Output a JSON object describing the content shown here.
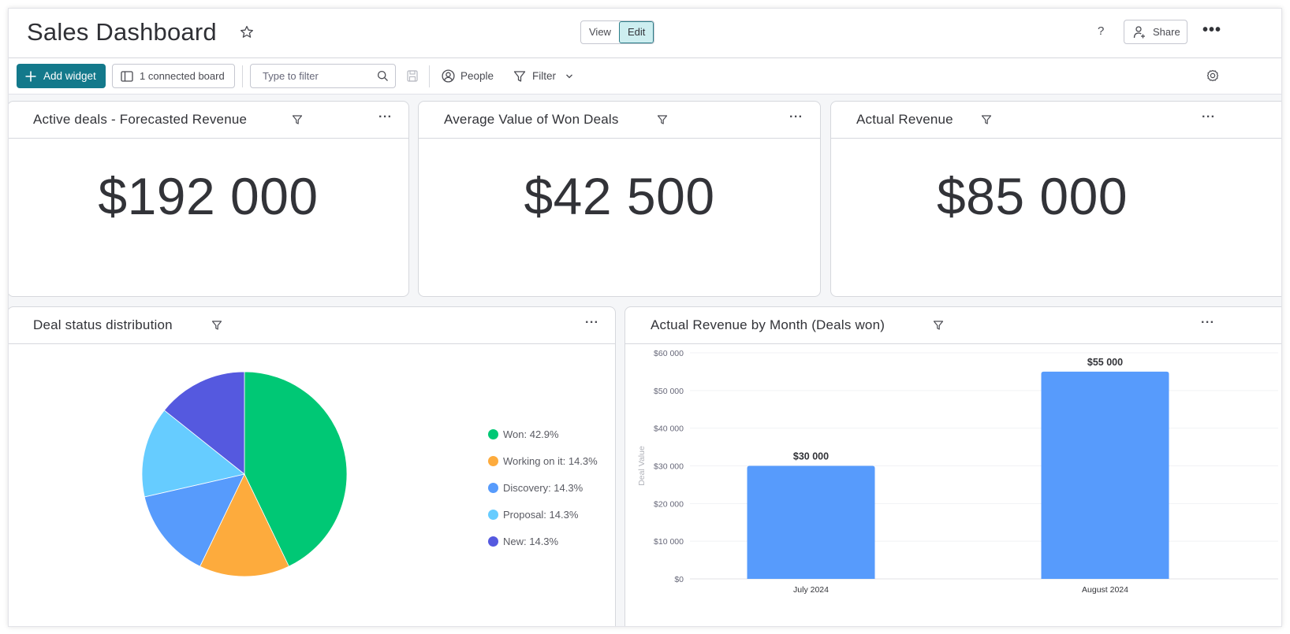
{
  "header": {
    "title": "Sales Dashboard",
    "view_label": "View",
    "edit_label": "Edit",
    "help_label": "?",
    "share_label": "Share"
  },
  "toolbar": {
    "add_widget_label": "Add widget",
    "connected_boards_label": "1 connected board",
    "filter_placeholder": "Type to filter",
    "filter_value": "",
    "people_label": "People",
    "filter_label": "Filter"
  },
  "widgets": {
    "forecast": {
      "title": "Active deals - Forecasted Revenue",
      "value": "$192 000"
    },
    "avg_won": {
      "title": "Average Value of Won Deals",
      "value": "$42 500"
    },
    "actual": {
      "title": "Actual Revenue",
      "value": "$85 000"
    },
    "status": {
      "title": "Deal status distribution"
    },
    "by_month": {
      "title": "Actual Revenue by Month (Deals won)"
    }
  },
  "chart_data": [
    {
      "type": "pie",
      "title": "Deal status distribution",
      "legend_position": "right",
      "slices": [
        {
          "label": "Won",
          "value": 42.9,
          "legend": "Won: 42.9%",
          "color": "#00c875"
        },
        {
          "label": "Working on it",
          "value": 14.3,
          "legend": "Working on it: 14.3%",
          "color": "#fdab3d"
        },
        {
          "label": "Discovery",
          "value": 14.3,
          "legend": "Discovery: 14.3%",
          "color": "#579bfc"
        },
        {
          "label": "Proposal",
          "value": 14.3,
          "legend": "Proposal: 14.3%",
          "color": "#66ccff"
        },
        {
          "label": "New",
          "value": 14.3,
          "legend": "New: 14.3%",
          "color": "#5559df"
        }
      ]
    },
    {
      "type": "bar",
      "title": "Actual Revenue by Month (Deals won)",
      "categories": [
        "July 2024",
        "August 2024"
      ],
      "values": [
        30000,
        55000
      ],
      "value_labels": [
        "$30 000",
        "$55 000"
      ],
      "xlabel": "",
      "ylabel": "Deal Value",
      "ylim": [
        0,
        60000
      ],
      "yticks": [
        0,
        10000,
        20000,
        30000,
        40000,
        50000,
        60000
      ],
      "ytick_labels": [
        "$0",
        "$10 000",
        "$20 000",
        "$30 000",
        "$40 000",
        "$50 000",
        "$60 000"
      ],
      "grid": true,
      "bar_color": "#579bfc"
    }
  ]
}
